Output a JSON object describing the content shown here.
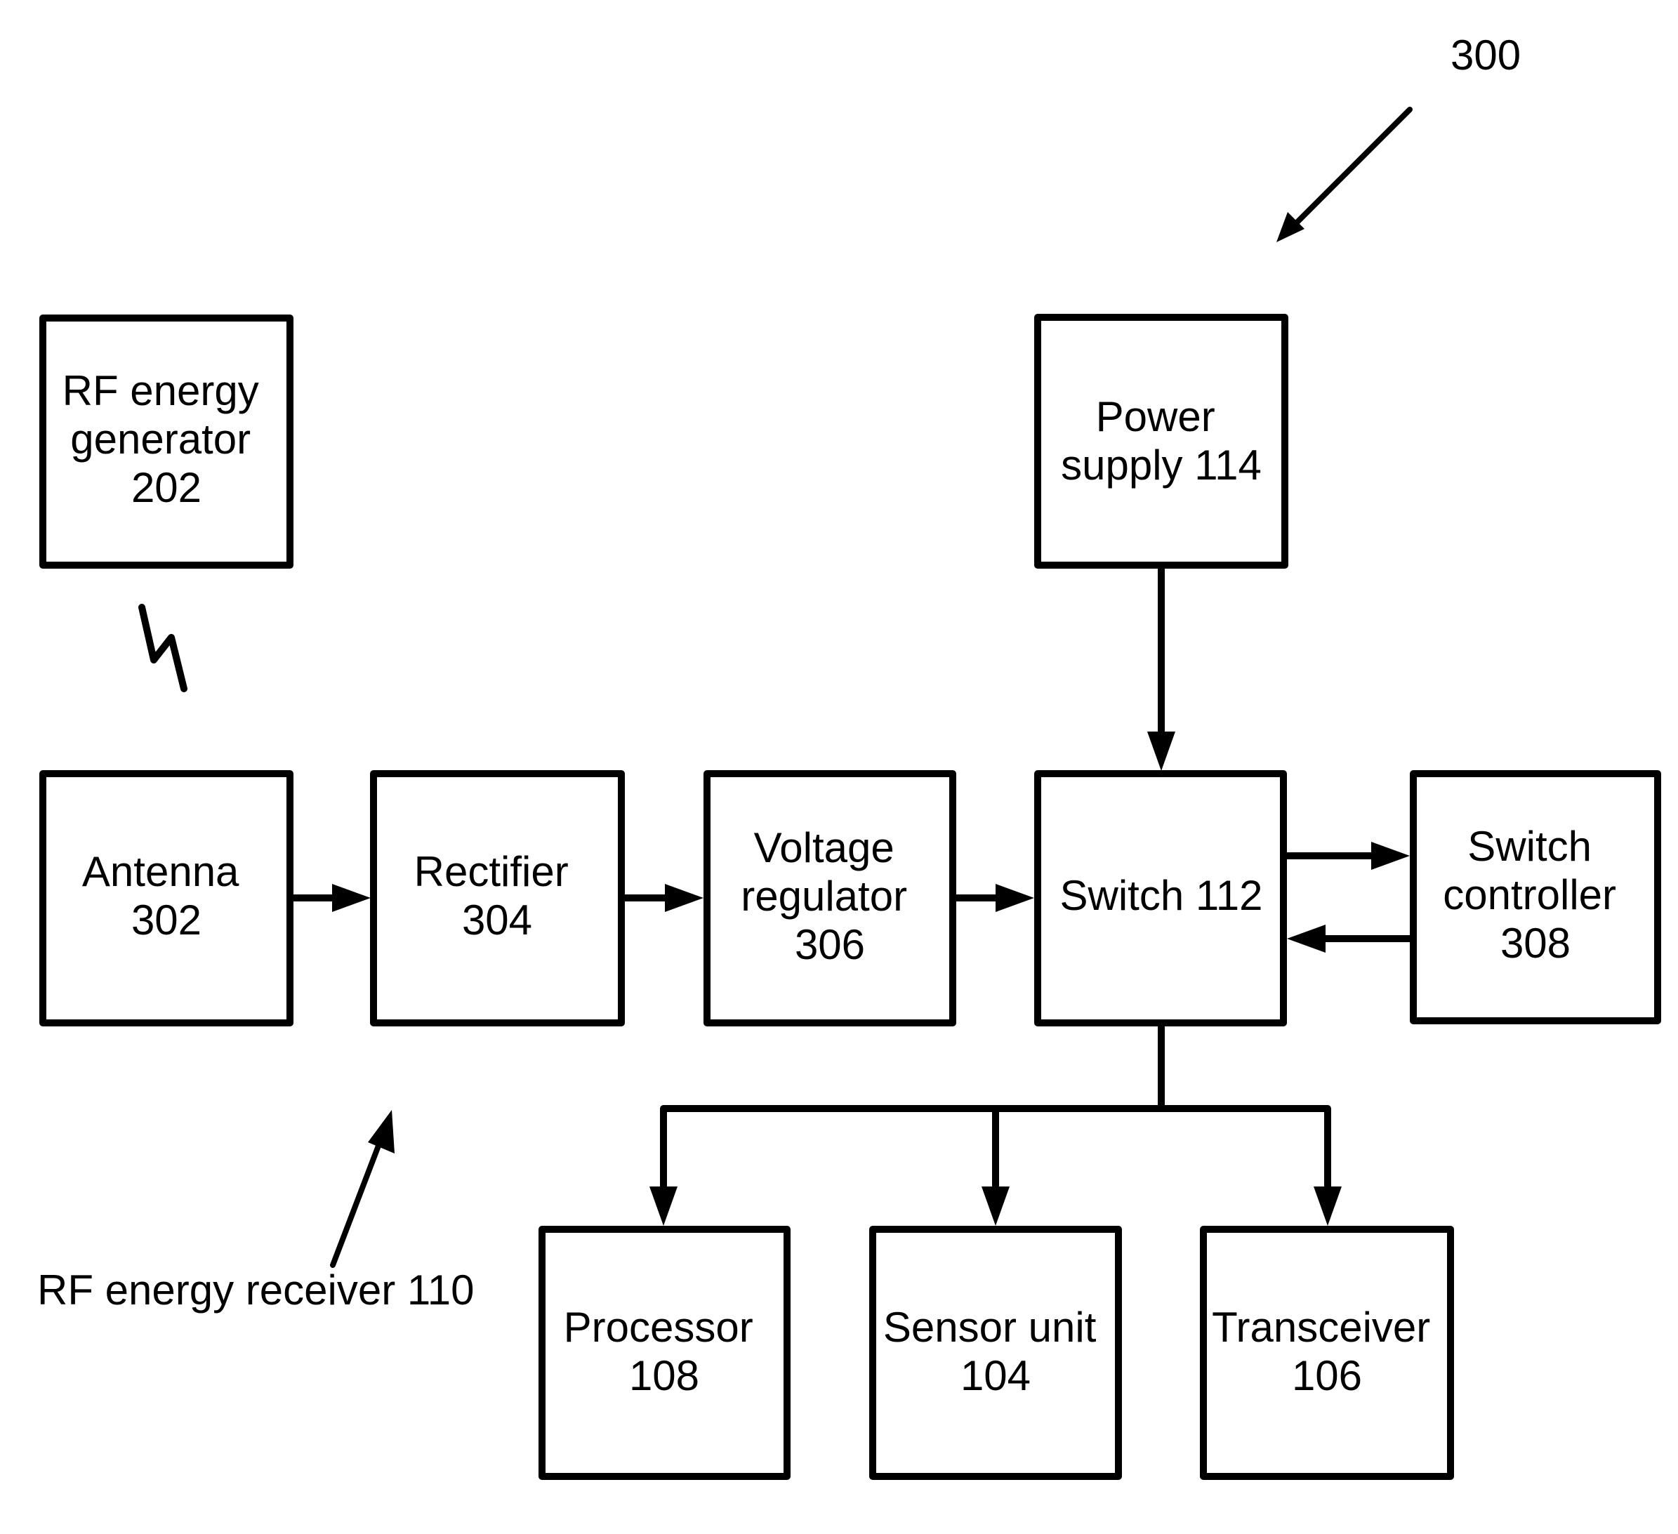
{
  "figure": {
    "reference": "300",
    "receiver_label": "RF energy receiver 110"
  },
  "blocks": {
    "rf_generator": {
      "lines": [
        "RF energy",
        "generator",
        "202"
      ]
    },
    "power_supply": {
      "lines": [
        "Power",
        "supply 114"
      ]
    },
    "antenna": {
      "lines": [
        "Antenna",
        "302"
      ]
    },
    "rectifier": {
      "lines": [
        "Rectifier",
        "304"
      ]
    },
    "voltage_regulator": {
      "lines": [
        "Voltage",
        "regulator",
        "306"
      ]
    },
    "switch": {
      "lines": [
        "Switch 112"
      ]
    },
    "switch_controller": {
      "lines": [
        "Switch",
        "controller",
        "308"
      ]
    },
    "processor": {
      "lines": [
        "Processor",
        "108"
      ]
    },
    "sensor_unit": {
      "lines": [
        "Sensor unit",
        "104"
      ]
    },
    "transceiver": {
      "lines": [
        "Transceiver",
        "106"
      ]
    }
  },
  "connections": [
    {
      "from": "antenna",
      "to": "rectifier"
    },
    {
      "from": "rectifier",
      "to": "voltage_regulator"
    },
    {
      "from": "voltage_regulator",
      "to": "switch"
    },
    {
      "from": "power_supply",
      "to": "switch"
    },
    {
      "from": "switch",
      "to": "switch_controller"
    },
    {
      "from": "switch_controller",
      "to": "switch"
    },
    {
      "from": "switch",
      "to": "processor"
    },
    {
      "from": "switch",
      "to": "sensor_unit"
    },
    {
      "from": "switch",
      "to": "transceiver"
    }
  ],
  "icons": {
    "wireless_link": "lightning-bolt"
  }
}
